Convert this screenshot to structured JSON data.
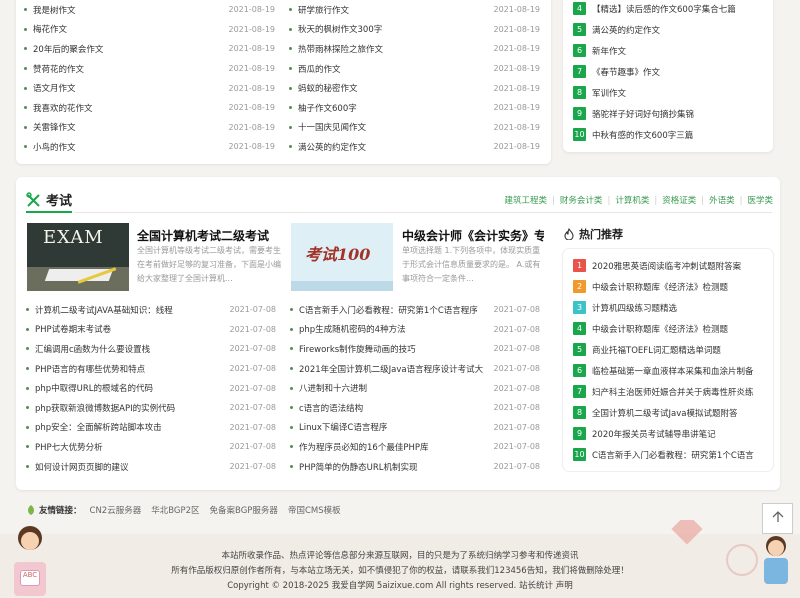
{
  "top_left_list": [
    {
      "title": "我是树作文",
      "date": "2021-08-19"
    },
    {
      "title": "梅花作文",
      "date": "2021-08-19"
    },
    {
      "title": "20年后的聚会作文",
      "date": "2021-08-19"
    },
    {
      "title": "赞荷花的作文",
      "date": "2021-08-19"
    },
    {
      "title": "语文月作文",
      "date": "2021-08-19"
    },
    {
      "title": "我喜欢的花作文",
      "date": "2021-08-19"
    },
    {
      "title": "关雷锋作文",
      "date": "2021-08-19"
    },
    {
      "title": "小鸟的作文",
      "date": "2021-08-19"
    }
  ],
  "top_mid_list": [
    {
      "title": "研学旅行作文",
      "date": "2021-08-19"
    },
    {
      "title": "秋天的枫树作文300字",
      "date": "2021-08-19"
    },
    {
      "title": "热带雨林探险之旅作文",
      "date": "2021-08-19"
    },
    {
      "title": "西瓜的作文",
      "date": "2021-08-19"
    },
    {
      "title": "蚂蚁的秘密作文",
      "date": "2021-08-19"
    },
    {
      "title": "柚子作文600字",
      "date": "2021-08-19"
    },
    {
      "title": "十一国庆见闻作文",
      "date": "2021-08-19"
    },
    {
      "title": "满公英的约定作文",
      "date": "2021-08-19"
    }
  ],
  "top_right_rank": [
    {
      "n": "4",
      "title": "【精选】读后感的作文600字集合七篇"
    },
    {
      "n": "5",
      "title": "满公英的约定作文"
    },
    {
      "n": "6",
      "title": "新年作文"
    },
    {
      "n": "7",
      "title": "《春节趣事》作文"
    },
    {
      "n": "8",
      "title": "军训作文"
    },
    {
      "n": "9",
      "title": "骆驼祥子好词好句摘抄集锦"
    },
    {
      "n": "10",
      "title": "中秋有感的作文600字三篇"
    }
  ],
  "exam_section": {
    "title": "考试",
    "categories": [
      "建筑工程类",
      "财务会计类",
      "计算机类",
      "资格证类",
      "外语类",
      "医学类"
    ],
    "feature1": {
      "title": "全国计算机考试二级考试",
      "desc": "全国计算机等级考试二级考试，需要考生在考前做好足够的复习准备，下面是小编给大家整理了全国计算机...",
      "img_text": "EXAM"
    },
    "feature2": {
      "title": "中级会计师《会计实务》专",
      "desc": "单项选择题 1.下列各项中，体现实质重于形式会计信息质量要求的是。 A.或有事项符合一定条件...",
      "img_text": "考试100"
    },
    "list_left": [
      {
        "title": "计算机二级考试JAVA基础知识：线程",
        "date": "2021-07-08"
      },
      {
        "title": "PHP试卷期末考试卷",
        "date": "2021-07-08"
      },
      {
        "title": "汇编调用c函数为什么要设置栈",
        "date": "2021-07-08"
      },
      {
        "title": "PHP语言的有哪些优势和特点",
        "date": "2021-07-08"
      },
      {
        "title": "php中取得URL的根域名的代码",
        "date": "2021-07-08"
      },
      {
        "title": "php获取新浪微博数据API的实例代码",
        "date": "2021-07-08"
      },
      {
        "title": "php安全：全面解析跨站脚本攻击",
        "date": "2021-07-08"
      },
      {
        "title": "PHP七大优势分析",
        "date": "2021-07-08"
      },
      {
        "title": "如何设计网页页脚的建议",
        "date": "2021-07-08"
      }
    ],
    "list_right": [
      {
        "title": "C语言新手入门必看教程：研究第1个C语言程序",
        "date": "2021-07-08"
      },
      {
        "title": "php生成随机密码的4种方法",
        "date": "2021-07-08"
      },
      {
        "title": "Fireworks制作旋舞动画的技巧",
        "date": "2021-07-08"
      },
      {
        "title": "2021年全国计算机二级Java语言程序设计考试大",
        "date": "2021-07-08"
      },
      {
        "title": "八进制和十六进制",
        "date": "2021-07-08"
      },
      {
        "title": "c语言的语法结构",
        "date": "2021-07-08"
      },
      {
        "title": "Linux下编译C语言程序",
        "date": "2021-07-08"
      },
      {
        "title": "作为程序员必知的16个最佳PHP库",
        "date": "2021-07-08"
      },
      {
        "title": "PHP简单的伪静态URL机制实现",
        "date": "2021-07-08"
      }
    ],
    "hot_title": "热门推荐",
    "hot": [
      {
        "n": "1",
        "title": "2020雅思英语阅读临考冲刺试题附答案",
        "color": "#e8534a"
      },
      {
        "n": "2",
        "title": "中级会计职称题库《经济法》检测题",
        "color": "#f09a2b"
      },
      {
        "n": "3",
        "title": "计算机四级练习题精选",
        "color": "#3cc3c8"
      },
      {
        "n": "4",
        "title": "中级会计职称题库《经济法》检测题",
        "color": "#1aa64a"
      },
      {
        "n": "5",
        "title": "商业托福TOEFL词汇题精选单词题",
        "color": "#1aa64a"
      },
      {
        "n": "6",
        "title": "临检基础第一章血液样本采集和血涂片制备",
        "color": "#1aa64a"
      },
      {
        "n": "7",
        "title": "妇产科主治医师妊娠合并关于病毒性肝炎练",
        "color": "#1aa64a"
      },
      {
        "n": "8",
        "title": "全国计算机二级考试Java模拟试题附答",
        "color": "#1aa64a"
      },
      {
        "n": "9",
        "title": "2020年报关员考试辅导串讲笔记",
        "color": "#1aa64a"
      },
      {
        "n": "10",
        "title": "C语言新手入门必看教程：研究第1个C语言",
        "color": "#1aa64a"
      }
    ]
  },
  "friend_links": {
    "label": "友情链接：",
    "items": [
      "CN2云服务器",
      "华北BGP2区",
      "免备案BGP服务器",
      "帝国CMS模板"
    ]
  },
  "footer": {
    "line1": "本站所收录作品、热点评论等信息部分来源互联网，目的只是为了系统归纳学习参考和传递资讯",
    "line2": "所有作品版权归原创作者所有，与本站立场无关，如不慎侵犯了你的权益，请联系我们123456告知，我们将做删除处理！",
    "line3": "Copyright © 2018-2025 我爱自学网 5aizixue.com All rights reserved. 站长统计 声明"
  },
  "colors": {
    "accent": "#1aa64a",
    "link_green": "#3a9a52"
  }
}
